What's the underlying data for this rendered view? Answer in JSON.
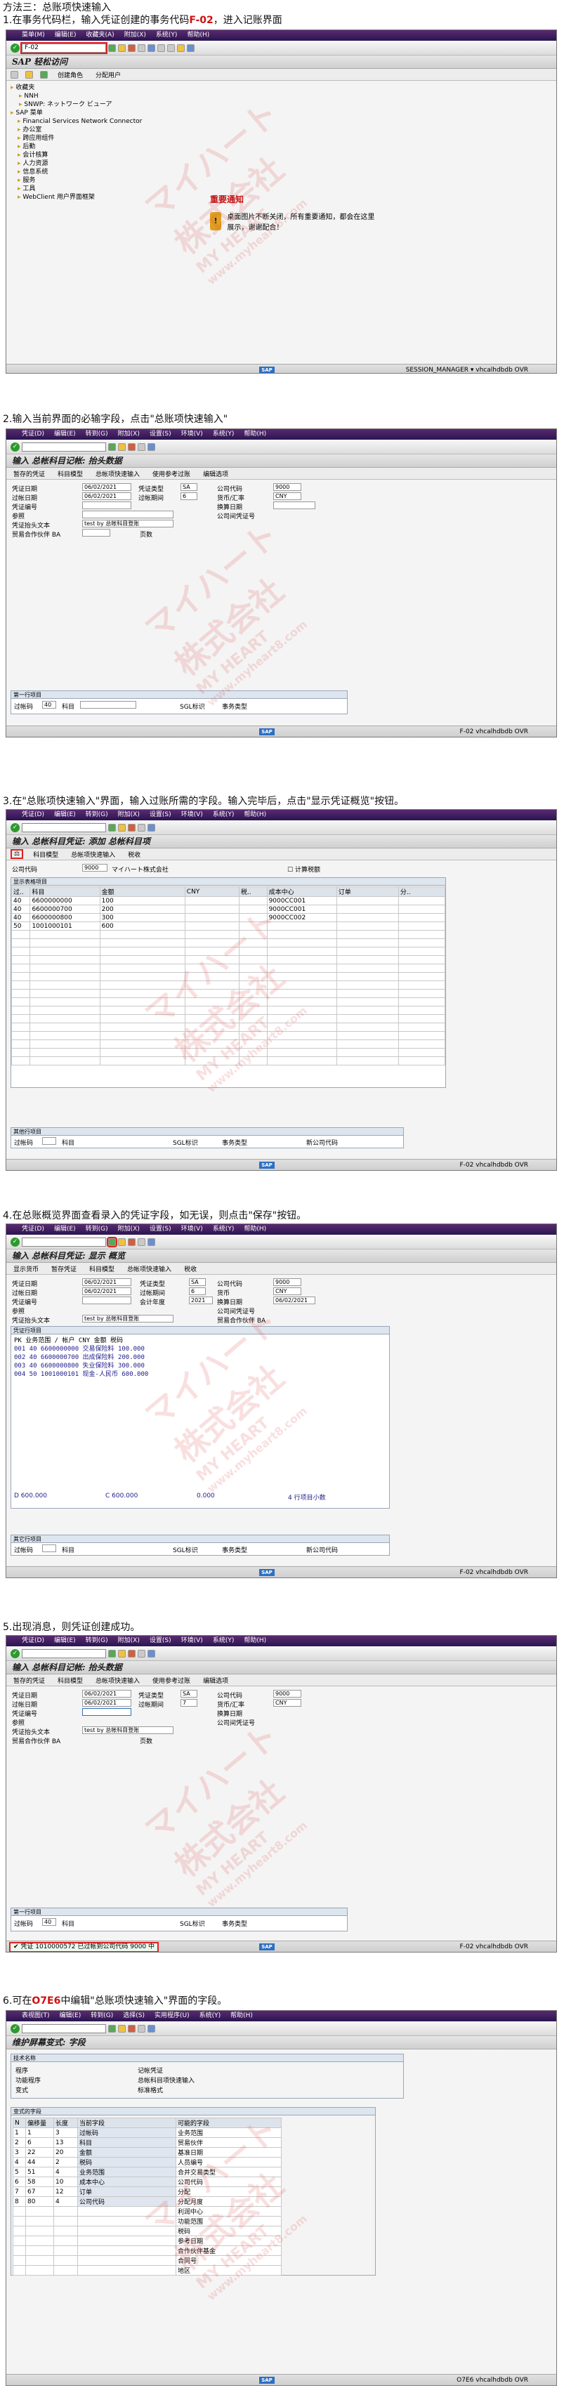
{
  "intro": "方法三：总账项快速输入",
  "colors": {
    "accent_red": "#e02020",
    "sap_menubar": "#3a1f5c"
  },
  "menu": {
    "s1": [
      "菜单(M)",
      "编辑(E)",
      "收藏夹(A)",
      "附加(X)",
      "系统(Y)",
      "帮助(H)"
    ],
    "s2": [
      "凭证(D)",
      "编辑(E)",
      "转到(G)",
      "附加(X)",
      "设置(S)",
      "环境(V)",
      "系统(Y)",
      "帮助(H)"
    ],
    "s6": [
      "表视图(T)",
      "编辑(E)",
      "转到(G)",
      "选择(S)",
      "实用程序(U)",
      "系统(Y)",
      "帮助(H)"
    ]
  },
  "step1": {
    "title_pre": "1.在事务代码栏，输入凭证创建的事务代码",
    "title_code": "F-02",
    "title_post": "，进入记账界面",
    "command": "F-02",
    "screen_title": "SAP 轻松访问",
    "toolbar_btns": [
      "创建角色",
      "分配用户"
    ],
    "tree": [
      "收藏夹",
      "NNH",
      "SNWP: ネットワーク ビューア",
      "SAP 菜单",
      "Financial Services Network Connector",
      "办公室",
      "跨应用组件",
      "后勤",
      "会计核算",
      "人力资源",
      "信息系统",
      "服务",
      "工具",
      "WebClient 用户界面框架"
    ],
    "notice_title": "重要通知",
    "notice_text": "桌面图片不断关闭，所有重要通知，都会在这里展示，谢谢配合！",
    "status_right": "SESSION_MANAGER ▾  vhcalhdbdb  OVR"
  },
  "step2": {
    "title": "2.输入当前界面的必输字段，点击\"总账项快速输入\"",
    "screen_title": "输入 总帐科目记帐: 抬头数据",
    "app_btns": [
      "暂存的凭证",
      "科目模型",
      "总帐项快速输入",
      "使用参考过账",
      "编辑选项"
    ],
    "labels": {
      "doc_date": "凭证日期",
      "doc_type": "凭证类型",
      "company": "公司代码",
      "post_date": "过帐日期",
      "period": "过帐期间",
      "currency": "货币/汇率",
      "doc_no": "凭证编号",
      "trans_date": "换算日期",
      "ref": "参照",
      "cc_no": "公司间凭证号",
      "header_text": "凭证抬头文本",
      "partner": "贸易合作伙伴 BA",
      "seg": "页数"
    },
    "values": {
      "doc_date": "06/02/2021",
      "doc_type": "SA",
      "company": "9000",
      "post_date": "06/02/2021",
      "period": "6",
      "currency": "CNY",
      "header_text": "test by 总帐科目登账"
    },
    "first_item_label": "第一行项目",
    "first_item": {
      "pk_label": "过帐码",
      "pk": "40",
      "acct_label": "科目",
      "sgl_label": "SGL标识",
      "ttype_label": "事务类型"
    },
    "status_right": "F-02  vhcalhdbdb  OVR"
  },
  "step3": {
    "title": "3.在\"总账项快速输入\"界面，输入过账所需的字段。输入完毕后，点击\"显示凭证概览\"按钮。",
    "screen_title": "输入 总帐科目凭证: 添加 总帐科目项",
    "app_btns": [
      "科目模型",
      "总帐项快速输入",
      "税收"
    ],
    "company_label": "公司代码",
    "company_val": "9000",
    "company_name": "マイハート株式会社",
    "tax_label": "计算税额",
    "table_label": "显示表格项目",
    "headers": [
      "过..",
      "科目",
      "金额",
      "CNY",
      "税..",
      "成本中心",
      "订单",
      "分.."
    ],
    "rows": [
      [
        "40",
        "6600000000",
        "100",
        "",
        "",
        "9000CC001",
        "",
        ""
      ],
      [
        "40",
        "6600000700",
        "200",
        "",
        "",
        "9000CC001",
        "",
        ""
      ],
      [
        "40",
        "6600000800",
        "300",
        "",
        "",
        "9000CC002",
        "",
        ""
      ],
      [
        "50",
        "1001000101",
        "600",
        "",
        "",
        "",
        "",
        ""
      ]
    ],
    "other_label": "其他行项目",
    "other": [
      "过帐码",
      "科目",
      "SGL标识",
      "事务类型",
      "新公司代码"
    ],
    "status_right": "F-02  vhcalhdbdb  OVR"
  },
  "step4": {
    "title": "4.在总账概览界面查看录入的凭证字段，如无误，则点击\"保存\"按钮。",
    "screen_title": "输入 总帐科目凭证: 显示 概览",
    "app_btns": [
      "显示货币",
      "暂存凭证",
      "科目模型",
      "总帐项快速输入",
      "税收"
    ],
    "labels": {
      "doc_date": "凭证日期",
      "post_date": "过帐日期",
      "doc_no": "凭证编号",
      "ref": "参照",
      "header_text": "凭证抬头文本",
      "items": "凭证行项目",
      "doc_type": "凭证类型",
      "period": "过帐期间",
      "fiscal": "会计年度",
      "company": "公司代码",
      "currency": "货币",
      "trans_date": "换算日期",
      "cc_no": "公司间凭证号",
      "partner": "贸易合作伙伴 BA"
    },
    "values": {
      "doc_date": "06/02/2021",
      "post_date": "06/02/2021",
      "doc_type": "SA",
      "period": "6",
      "fiscal": "2021",
      "company": "9000",
      "currency": "CNY",
      "trans_date": "06/02/2021",
      "header_text": "test by 总帐科目登账"
    },
    "item_header": [
      "PK",
      "业务范围 / 帐户",
      "CNY",
      "金额",
      "税码"
    ],
    "items": [
      [
        "001",
        "40",
        "6600000000",
        "交易保险料",
        "100.000"
      ],
      [
        "002",
        "40",
        "6600000700",
        "出成保险料",
        "200.000"
      ],
      [
        "003",
        "40",
        "6600000800",
        "失业保险料",
        "300.000"
      ],
      [
        "004",
        "50",
        "1001000101",
        "现金-人民币",
        "600.000"
      ]
    ],
    "totals": {
      "d": "D 600.000",
      "c": "C 600.000",
      "bal": "0.000",
      "lines": "4 行项目小数"
    },
    "other_label": "其它行项目",
    "other": [
      "过帐码",
      "科目",
      "SGL标识",
      "事务类型",
      "新公司代码"
    ],
    "status_right": "F-02  vhcalhdbdb  OVR"
  },
  "step5": {
    "title": "5.出现消息，则凭证创建成功。",
    "screen_title": "输入 总帐科目记帐: 抬头数据",
    "app_btns": [
      "暂存的凭证",
      "科目模型",
      "总帐项快速输入",
      "使用参考过账",
      "编辑选项"
    ],
    "values": {
      "doc_date": "06/02/2021",
      "doc_type": "SA",
      "company": "9000",
      "post_date": "06/02/2021",
      "period": "7",
      "currency": "CNY",
      "header_text": "test by 总帐科目登账"
    },
    "status_msg": "凭证 1010000572 已过帐到公司代码 9000 中",
    "status_right": "F-02  vhcalhdbdb  OVR"
  },
  "step6": {
    "title_pre": "6.可在",
    "title_code": "O7E6",
    "title_post": "中编辑\"总账项快速输入\"界面的字段。",
    "screen_title": "维护屏幕变式: 字段",
    "section": "技术名称",
    "labels": [
      "程序",
      "功能程序",
      "变式"
    ],
    "values": [
      "记帐凭证",
      "总帐科目项快速输入",
      "标准格式"
    ],
    "var_label": "变式的字段",
    "headers": [
      "N",
      "偏移量",
      "长度",
      "当前字段",
      "可能的字段"
    ],
    "rows": [
      [
        "1",
        "1",
        "3",
        "过帐码",
        "业务范围"
      ],
      [
        "2",
        "6",
        "13",
        "科目",
        "贸易伙伴"
      ],
      [
        "3",
        "22",
        "20",
        "金额",
        "基准日期"
      ],
      [
        "4",
        "44",
        "2",
        "税码",
        "人员编号"
      ],
      [
        "5",
        "51",
        "4",
        "业务范围",
        "合并交易类型"
      ],
      [
        "6",
        "58",
        "10",
        "成本中心",
        "公司代码"
      ],
      [
        "7",
        "67",
        "12",
        "订单",
        "分配"
      ],
      [
        "8",
        "80",
        "4",
        "公司代码",
        "分配月度"
      ],
      [
        "",
        "",
        "",
        "",
        "利润中心"
      ],
      [
        "",
        "",
        "",
        "",
        "功能范围"
      ],
      [
        "",
        "",
        "",
        "",
        "税码"
      ],
      [
        "",
        "",
        "",
        "",
        "参考日期"
      ],
      [
        "",
        "",
        "",
        "",
        "合作伙伴基金"
      ],
      [
        "",
        "",
        "",
        "",
        "合同号"
      ],
      [
        "",
        "",
        "",
        "",
        "地区"
      ]
    ],
    "status_right": "O7E6  vhcalhdbdb  OVR"
  },
  "watermark": {
    "line1": "マイハート",
    "line2": "株式会社",
    "line3": "MY HEART",
    "line4": "www.myheart8.com"
  }
}
